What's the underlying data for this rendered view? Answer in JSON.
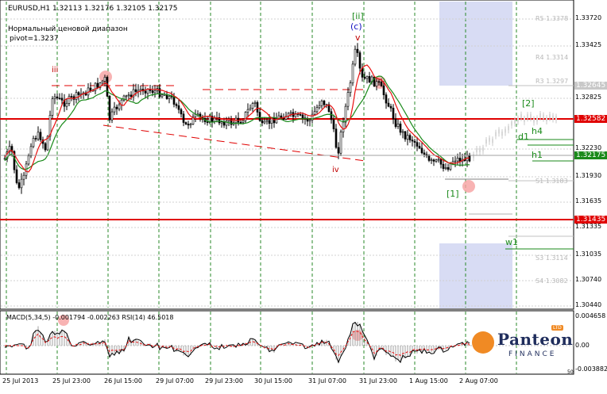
{
  "window": {
    "symbol_line": "EURUSD,H1  1.32113  1.32176  1.32105  1.32175",
    "indicator_title": "Нормальный ценовой диапазон",
    "pivot_label": "pivot=1.3237"
  },
  "price_axis": {
    "ticks": [
      "1.33720",
      "1.33425",
      "1.32825",
      "1.32530",
      "1.32230",
      "1.31930",
      "1.31635",
      "1.31335",
      "1.31035",
      "1.30740",
      "1.30440"
    ],
    "current_price": "1.32175",
    "highlight_red": [
      "1.32582",
      "1.31435"
    ],
    "pivot_tag": "1.32645"
  },
  "time_axis": {
    "labels": [
      "25 Jul 2013",
      "25 Jul 23:00",
      "26 Jul 15:00",
      "29 Jul 07:00",
      "29 Jul 23:00",
      "30 Jul 15:00",
      "31 Jul 07:00",
      "31 Jul 23:00",
      "1 Aug 15:00",
      "2 Aug 07:00"
    ]
  },
  "chart_labels": {
    "wave_iii": "iii",
    "wave_ii": "[ii]",
    "wave_c": "(c)",
    "wave_v": "v",
    "wave_iv": "iv",
    "wave_1": "[1]",
    "wave_2": "[2]",
    "h4": "h4",
    "d1": "d1",
    "h1": "h1",
    "w1": "w1"
  },
  "range_levels": {
    "r5": "R5 1.3378",
    "r4": "R4 1.3314",
    "r3": "R3 1.3297",
    "s1": "S1 1.3183",
    "s3": "S3 1.3114",
    "s4": "S4 1.3082"
  },
  "macd_panel": {
    "label": "MACD(5,34,5) -0.001794 -0.002263  RSI(14) 46.5018",
    "axis_top": "0.004658",
    "axis_mid": "0.00",
    "axis_bottom": "-0.003882",
    "level_50": "50"
  },
  "branding": {
    "name": "Panteon",
    "sub": "FINANCE",
    "badge": "LTD"
  },
  "colors": {
    "bull": "#ffffff",
    "bear": "#000000",
    "ma_fast": "#e81010",
    "ma_slow": "#1a8a1a",
    "level_red": "#e00000",
    "grid_green": "#2a8a2a",
    "zone_blue": "#d8dcf4"
  }
}
